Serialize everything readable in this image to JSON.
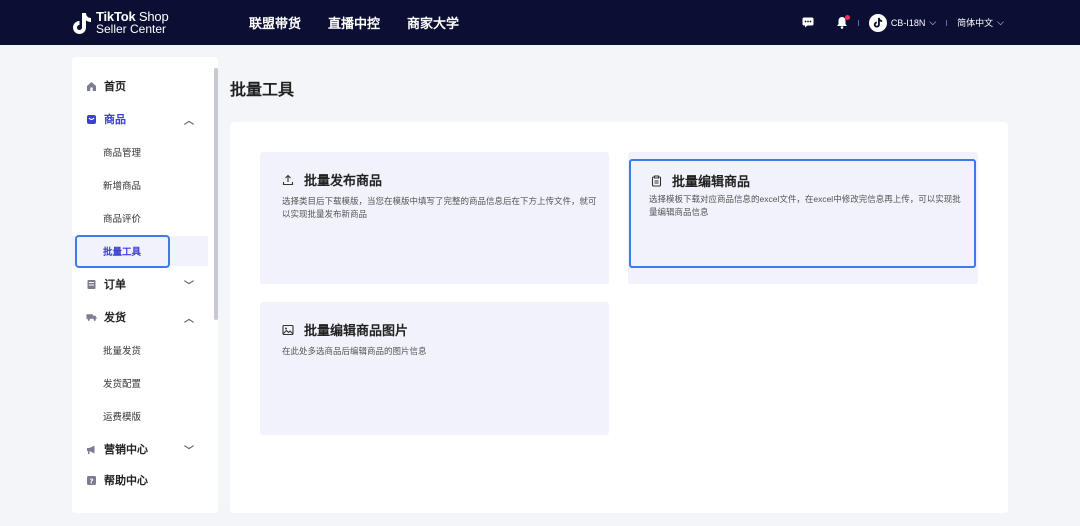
{
  "topbar": {
    "logo_line1_bold": "TikTok",
    "logo_line1_rest": " Shop",
    "logo_line2": "Seller Center",
    "nav": [
      "联盟带货",
      "直播中控",
      "商家大学"
    ],
    "account": "CB-I18N",
    "language": "简体中文",
    "notification_dot_color": "#fe2c55"
  },
  "sidebar": {
    "items": [
      {
        "label": "首页",
        "icon": "home-icon"
      },
      {
        "label": "商品",
        "icon": "product-icon",
        "expanded": true
      },
      {
        "label": "商品管理"
      },
      {
        "label": "新增商品"
      },
      {
        "label": "商品评价"
      },
      {
        "label": "批量工具",
        "selected": true
      },
      {
        "label": "订单",
        "icon": "order-icon",
        "expanded": false
      },
      {
        "label": "发货",
        "icon": "shipping-icon",
        "expanded": true
      },
      {
        "label": "批量发货"
      },
      {
        "label": "发货配置"
      },
      {
        "label": "运费模版"
      },
      {
        "label": "营销中心",
        "icon": "megaphone-icon",
        "expanded": false
      },
      {
        "label": "帮助中心",
        "icon": "help-icon"
      }
    ]
  },
  "main": {
    "title": "批量工具",
    "cards": [
      {
        "title": "批量发布商品",
        "icon": "upload-icon",
        "desc": "选择类目后下载模版，当您在模版中填写了完整的商品信息后在下方上传文件，就可以实现批量发布新商品"
      },
      {
        "title": "批量编辑商品",
        "icon": "clipboard-icon",
        "desc": "选择模板下载对应商品信息的excel文件，在excel中修改完信息再上传，可以实现批量编辑商品信息"
      },
      {
        "title": "批量编辑商品图片",
        "icon": "image-icon",
        "desc": "在此处多选商品后编辑商品的图片信息"
      }
    ]
  },
  "colors": {
    "topbar_bg": "#0b0f33",
    "accent": "#3b3fd6",
    "highlight_border": "#3e7be8"
  }
}
